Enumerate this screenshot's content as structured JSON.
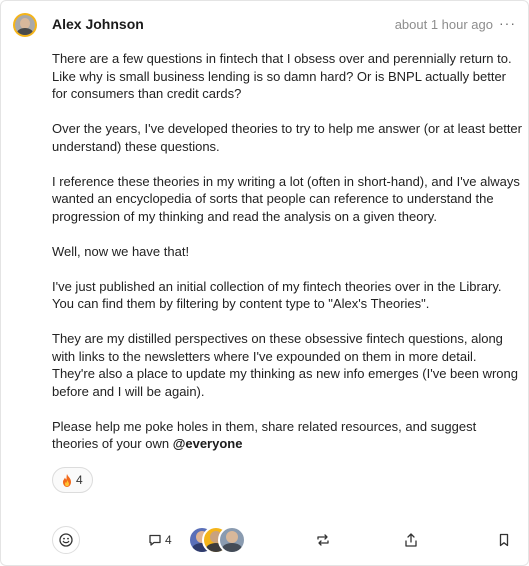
{
  "post": {
    "author": "Alex Johnson",
    "timestamp": "about 1 hour ago",
    "more_icon": "ellipsis-icon",
    "paragraphs": [
      "There are a few questions in fintech that I obsess over and perennially return to. Like why is small business lending is so damn hard? Or is BNPL actually better for consumers than credit cards?",
      "Over the years, I've developed theories to try to help me answer (or at least better understand) these questions.",
      "I reference these theories in my writing a lot (often in short-hand), and I've always wanted an encyclopedia of sorts that people can reference to understand the progression of my thinking and read the analysis on a given theory.",
      "Well, now we have that!",
      "I've just published an initial collection of my fintech theories over in the Library. You can find them by filtering by content type to \"Alex's Theories\".",
      "They are my distilled perspectives on these obsessive fintech questions, along with links to the newsletters where I've expounded on them in more detail. They're also a place to update my thinking as new info emerges (I've been wrong before and I will be again)."
    ],
    "last_paragraph_text": "Please help me poke holes in them, share related resources, and suggest theories of your own ",
    "mention": "@everyone"
  },
  "reaction": {
    "icon": "fire-icon",
    "count": "4"
  },
  "actions": {
    "emoji_icon": "smiley-icon",
    "comment_icon": "comment-icon",
    "comment_count": "4",
    "repost_icon": "repost-icon",
    "share_icon": "share-icon",
    "bookmark_icon": "bookmark-icon"
  },
  "colors": {
    "avatar_ring": "#f4b41a",
    "timestamp": "#8d8d8d",
    "border": "#e4e4e4"
  }
}
